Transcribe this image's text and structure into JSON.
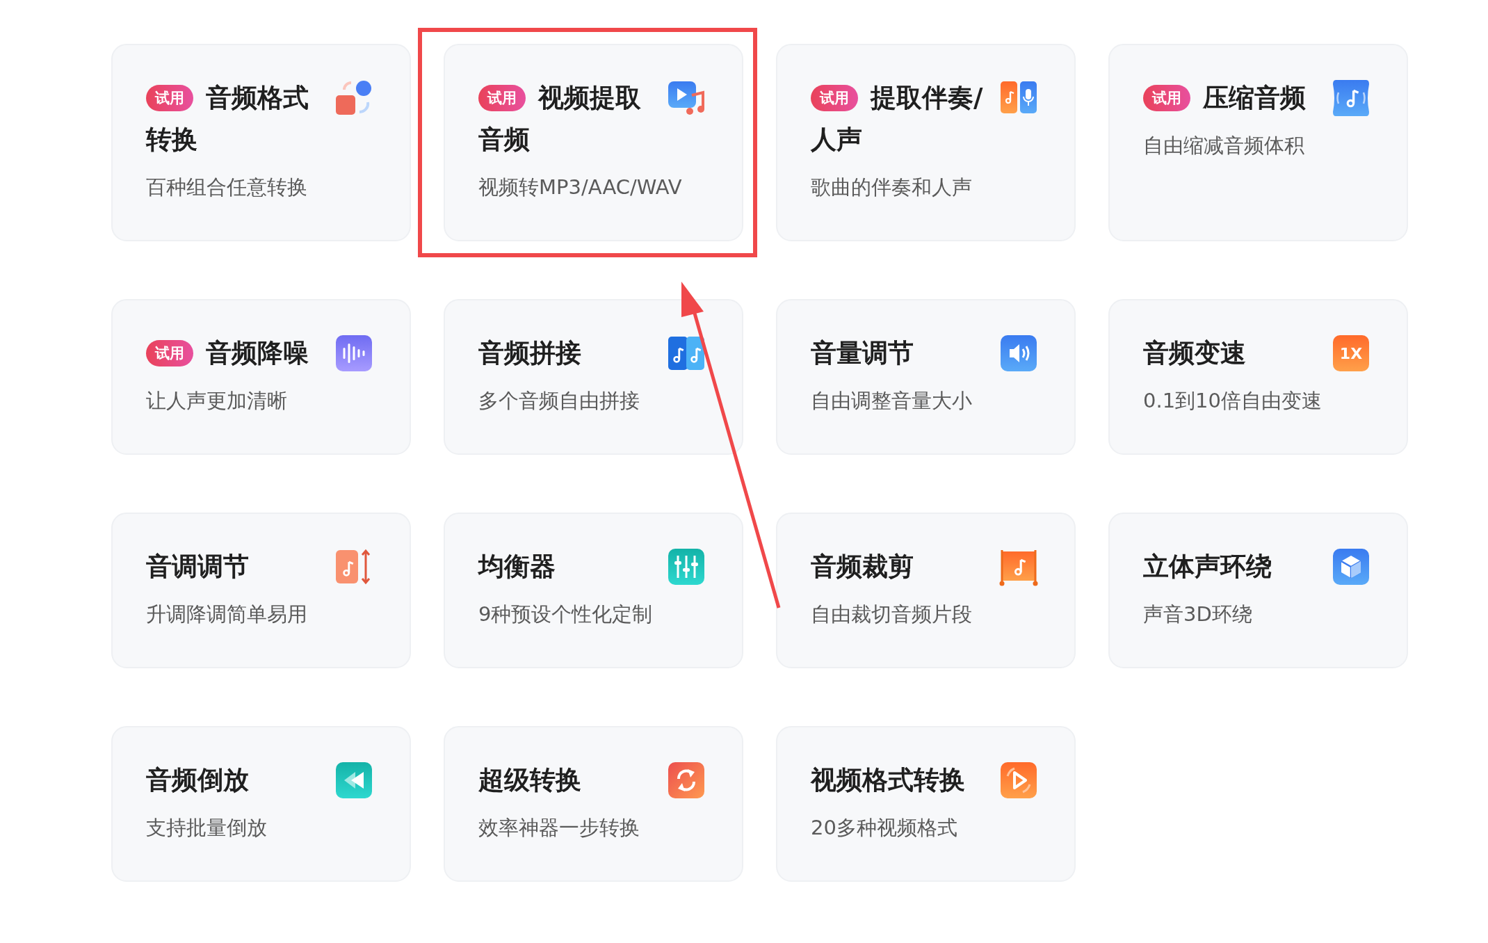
{
  "cards": [
    {
      "badge": "试用",
      "title": [
        "音频格式",
        "转换"
      ],
      "subtitle": "百种组合任意转换"
    },
    {
      "badge": "试用",
      "title": [
        "视频提取",
        "音频"
      ],
      "subtitle": "视频转MP3/AAC/WAV"
    },
    {
      "badge": "试用",
      "title": [
        "提取伴奏/",
        "人声"
      ],
      "subtitle": "歌曲的伴奏和人声"
    },
    {
      "badge": "试用",
      "title": [
        "压缩音频"
      ],
      "subtitle": "自由缩减音频体积"
    },
    {
      "badge": "试用",
      "title": [
        "音频降噪"
      ],
      "subtitle": "让人声更加清晰"
    },
    {
      "title": [
        "音频拼接"
      ],
      "subtitle": "多个音频自由拼接"
    },
    {
      "title": [
        "音量调节"
      ],
      "subtitle": "自由调整音量大小"
    },
    {
      "title": [
        "音频变速"
      ],
      "subtitle": "0.1到10倍自由变速",
      "icon_label": "1X"
    },
    {
      "title": [
        "音调调节"
      ],
      "subtitle": "升调降调简单易用"
    },
    {
      "title": [
        "均衡器"
      ],
      "subtitle": "9种预设个性化定制"
    },
    {
      "title": [
        "音频裁剪"
      ],
      "subtitle": "自由裁切音频片段"
    },
    {
      "title": [
        "立体声环绕"
      ],
      "subtitle": "声音3D环绕"
    },
    {
      "title": [
        "音频倒放"
      ],
      "subtitle": "支持批量倒放"
    },
    {
      "title": [
        "超级转换"
      ],
      "subtitle": "效率神器一步转换"
    },
    {
      "title": [
        "视频格式转换"
      ],
      "subtitle": "20多种视频格式"
    }
  ]
}
